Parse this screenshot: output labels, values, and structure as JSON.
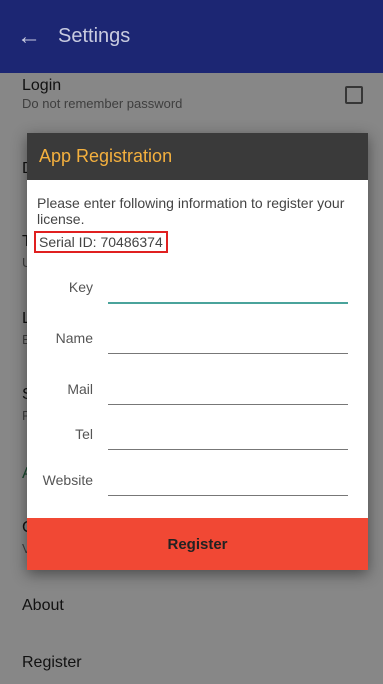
{
  "appbar": {
    "back_glyph": "←",
    "title": "Settings"
  },
  "settings": {
    "login": {
      "title": "Login",
      "summary": "Do not remember password"
    },
    "peek_letters": [
      "D",
      "T",
      "U",
      "L",
      "E",
      "S",
      "F",
      "A",
      "C",
      "V"
    ],
    "about": "About",
    "register": "Register"
  },
  "dialog": {
    "title": "App Registration",
    "message": "Please enter following information to register your license.",
    "serial": "Serial ID: 70486374",
    "fields": [
      {
        "label": "Key",
        "value": ""
      },
      {
        "label": "Name",
        "value": ""
      },
      {
        "label": "Mail",
        "value": ""
      },
      {
        "label": "Tel",
        "value": ""
      },
      {
        "label": "Website",
        "value": ""
      }
    ],
    "register_button": "Register"
  },
  "colors": {
    "appbar": "#1c2673",
    "dialog_title": "#f4b03e",
    "dialog_header": "#3a3a3a",
    "register_button": "#f14834",
    "serial_border": "#e02020",
    "focused_field_line": "#4aa39b"
  },
  "icons": {
    "back": "arrow-left-icon",
    "checkbox": "checkbox-unchecked-icon"
  }
}
